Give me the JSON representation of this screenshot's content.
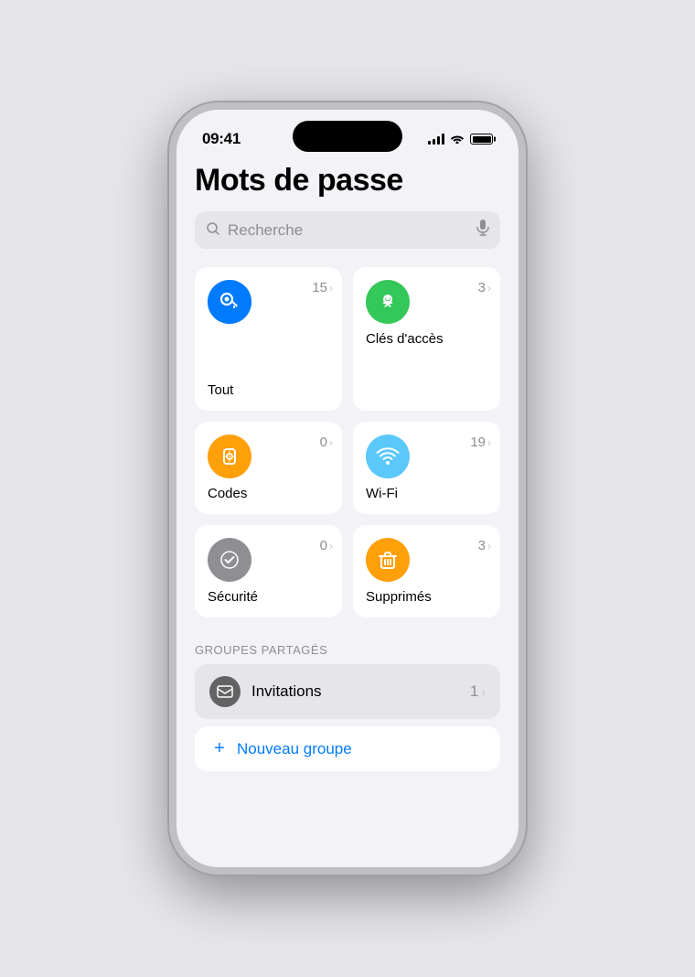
{
  "status_bar": {
    "time": "09:41"
  },
  "page": {
    "title": "Mots de passe"
  },
  "search": {
    "placeholder": "Recherche"
  },
  "cards": [
    {
      "id": "tout",
      "label": "Tout",
      "count": "15",
      "icon": "🔑",
      "icon_class": "icon-blue"
    },
    {
      "id": "cles",
      "label": "Clés d'accès",
      "count": "3",
      "icon": "👤",
      "icon_class": "icon-green"
    },
    {
      "id": "codes",
      "label": "Codes",
      "count": "0",
      "icon": "🔒",
      "icon_class": "icon-yellow"
    },
    {
      "id": "wifi",
      "label": "Wi-Fi",
      "count": "19",
      "icon": "📶",
      "icon_class": "icon-teal"
    },
    {
      "id": "securite",
      "label": "Sécurité",
      "count": "0",
      "icon": "✓",
      "icon_class": "icon-gray"
    },
    {
      "id": "supprimes",
      "label": "Supprimés",
      "count": "3",
      "icon": "🗑",
      "icon_class": "icon-orange"
    }
  ],
  "sections": {
    "shared_groups": {
      "label": "GROUPES PARTAGÉS",
      "items": [
        {
          "id": "invitations",
          "label": "Invitations",
          "count": "1"
        }
      ]
    }
  },
  "new_group": {
    "label": "Nouveau groupe"
  }
}
